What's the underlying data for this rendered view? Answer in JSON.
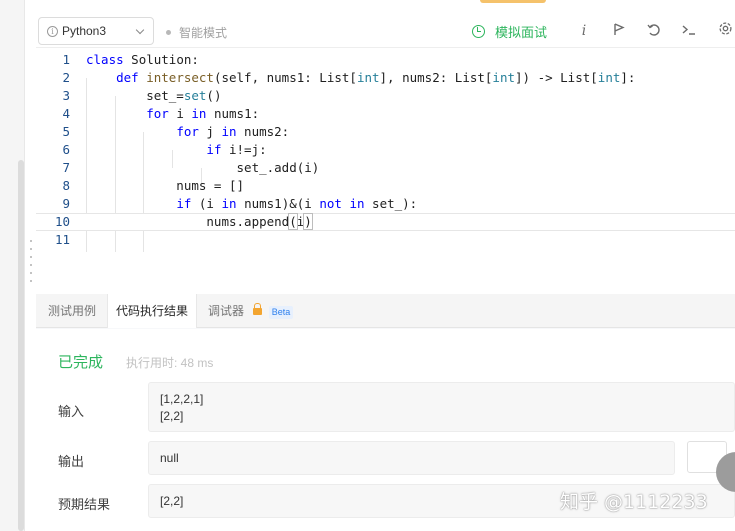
{
  "toolbar": {
    "language": "Python3",
    "smart_mode": "智能模式",
    "mock_interview": "模拟面试",
    "icons": [
      "info-icon",
      "run-icon",
      "reset-icon",
      "console-icon",
      "settings-icon"
    ]
  },
  "editor": {
    "lines": [
      {
        "n": "1"
      },
      {
        "n": "2"
      },
      {
        "n": "3"
      },
      {
        "n": "4"
      },
      {
        "n": "5"
      },
      {
        "n": "6"
      },
      {
        "n": "7"
      },
      {
        "n": "8"
      },
      {
        "n": "9"
      },
      {
        "n": "10"
      },
      {
        "n": "11"
      }
    ]
  },
  "bottom": {
    "tabs": [
      "测试用例",
      "代码执行结果",
      "调试器"
    ],
    "beta": "Beta",
    "status": "已完成",
    "exec_time": "执行用时: 48 ms",
    "input_label": "输入",
    "input_line1": "[1,2,2,1]",
    "input_line2": "[2,2]",
    "output_label": "输出",
    "output_value": "null",
    "expected_label": "预期结果",
    "expected_value": "[2,2]"
  },
  "watermark": "知乎 @1112233",
  "colors": {
    "accent_green": "#2db55d",
    "keyword_blue": "#0000ff",
    "beta_blue": "#2f80ed",
    "lock_orange": "#f3a530"
  }
}
